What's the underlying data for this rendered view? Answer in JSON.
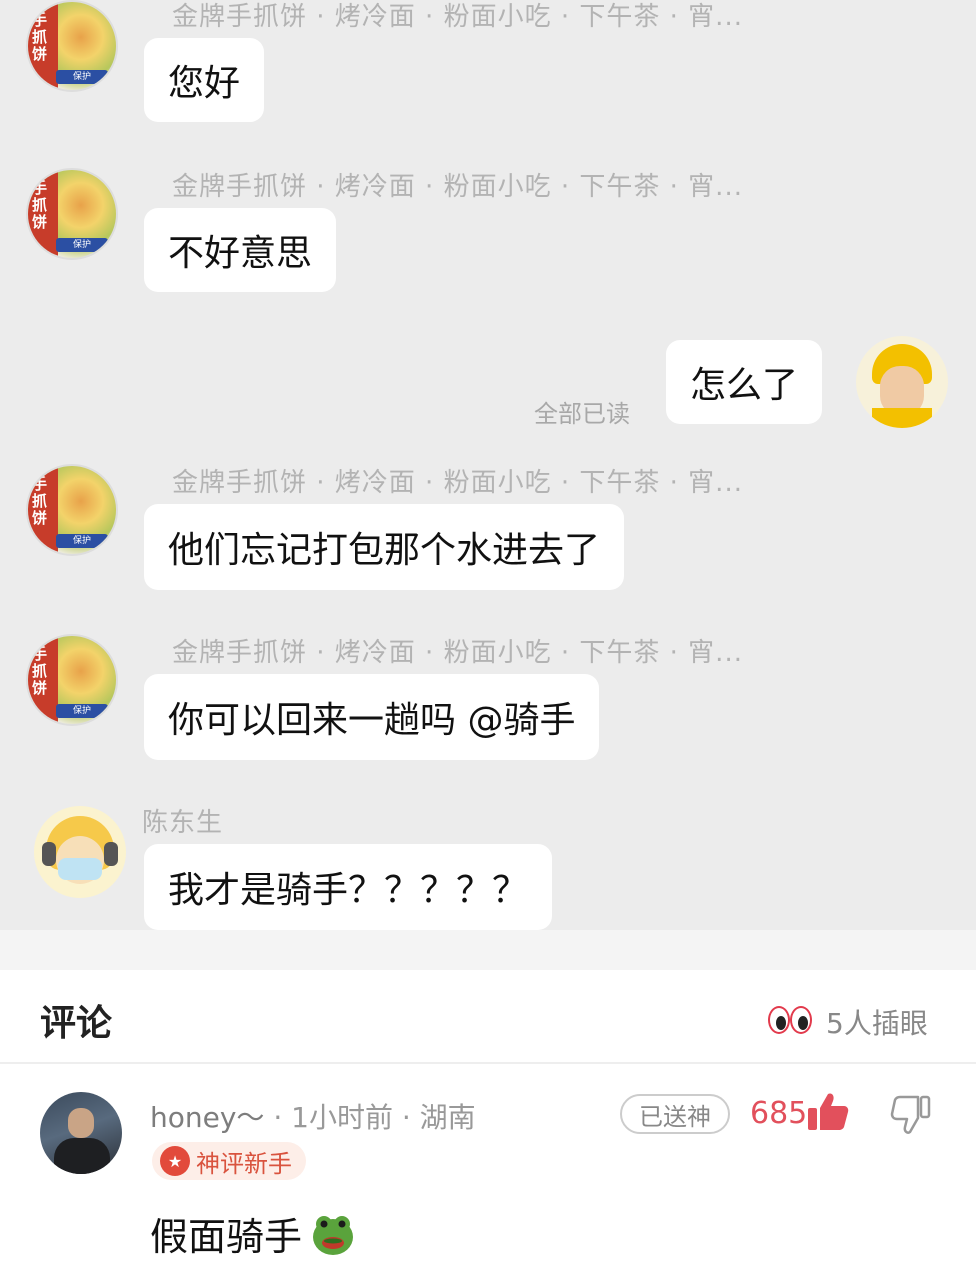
{
  "chat": {
    "shop_avatar_text": "手抓饼",
    "shop_avatar_tag": "保护",
    "messages": [
      {
        "sender": "金牌手抓饼 · 烤冷面 · 粉面小吃 · 下午茶 · 宵...",
        "text": "您好"
      },
      {
        "sender": "金牌手抓饼 · 烤冷面 · 粉面小吃 · 下午茶 · 宵...",
        "text": "不好意思"
      },
      {
        "text": "怎么了",
        "status": "全部已读"
      },
      {
        "sender": "金牌手抓饼 · 烤冷面 · 粉面小吃 · 下午茶 · 宵...",
        "text": "他们忘记打包那个水进去了"
      },
      {
        "sender": "金牌手抓饼 · 烤冷面 · 粉面小吃 · 下午茶 · 宵...",
        "text": "你可以回来一趟吗 @骑手"
      },
      {
        "sender": "陈东生",
        "text": "我才是骑手？？？？？"
      }
    ]
  },
  "comments": {
    "title": "评论",
    "peek_count": "5人插眼",
    "items": [
      {
        "username": "honey～",
        "time": "· 1小时前",
        "location": "· 湖南",
        "badge": "神评新手",
        "sent_label": "已送神",
        "likes": "685",
        "text": "假面骑手"
      }
    ]
  },
  "icons": {
    "peek": "eyes-icon",
    "like": "thumb-up-icon",
    "dislike": "thumb-down-icon",
    "emoji": "frog-emoji-icon",
    "badge": "god-comment-badge-icon"
  },
  "colors": {
    "accent": "#e2505c",
    "badge_text": "#d9533e",
    "chat_background": "#ececec"
  }
}
